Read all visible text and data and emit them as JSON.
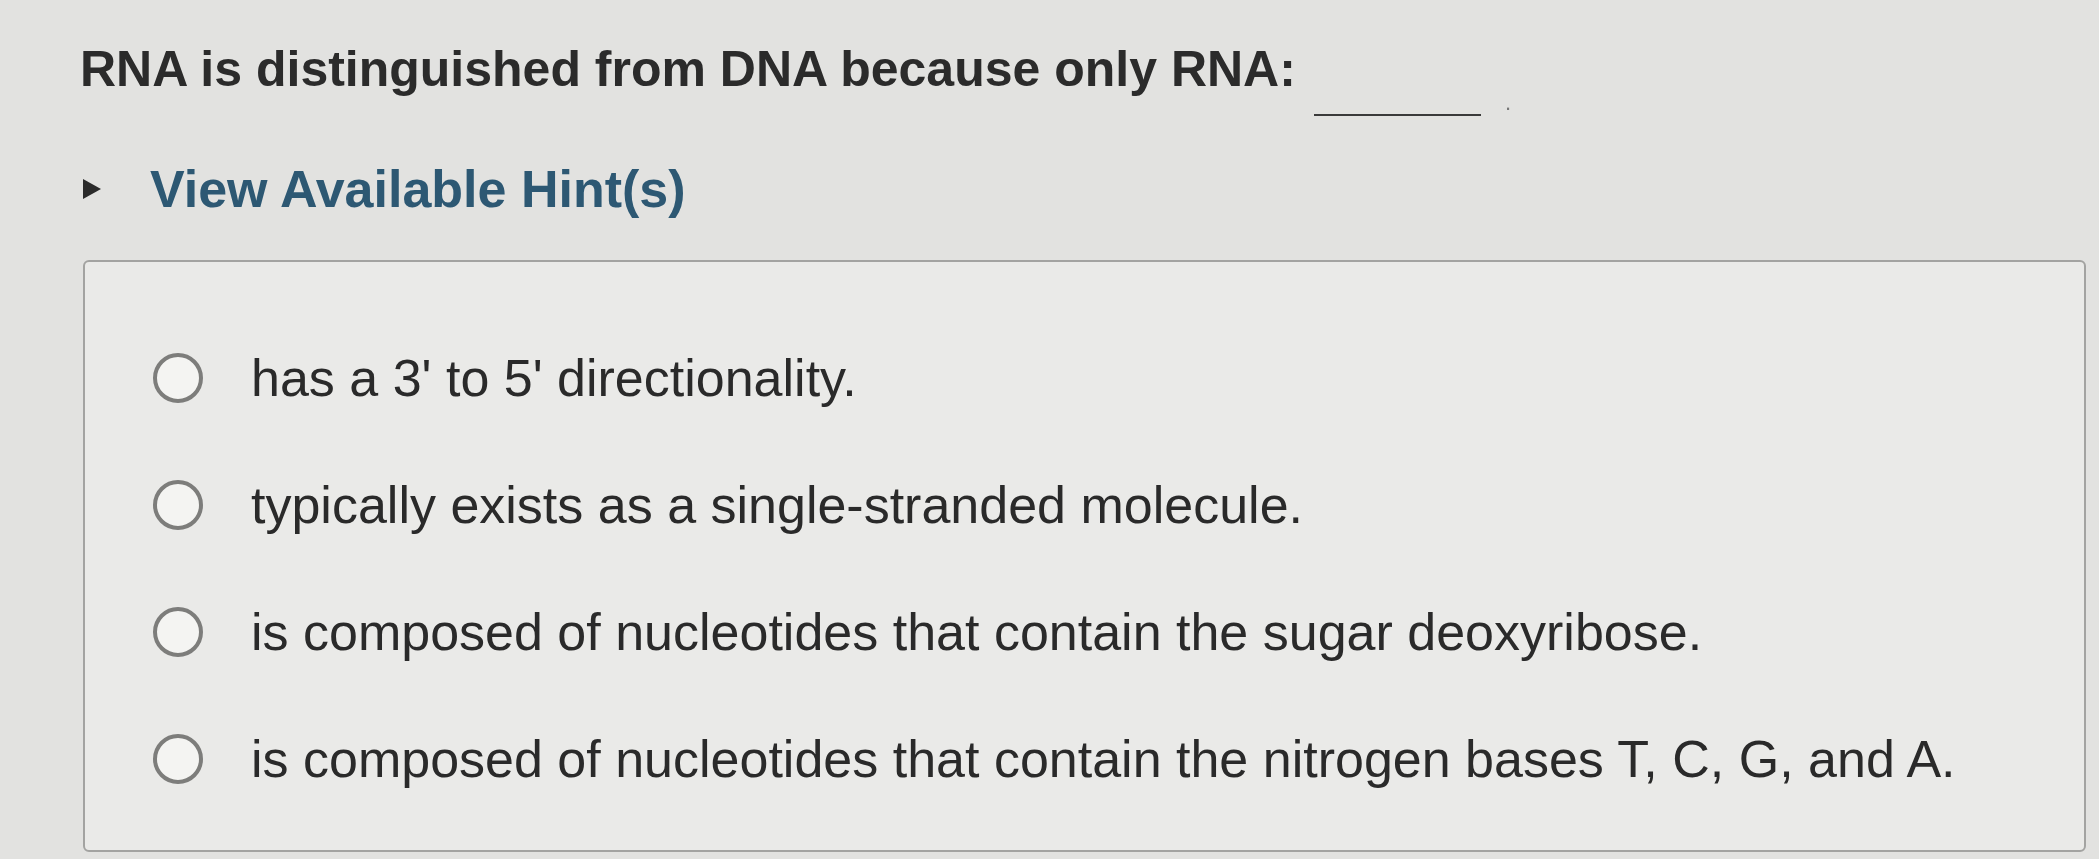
{
  "question": {
    "before_blank": "RNA is distinguished from DNA because only RNA:",
    "after_blank": "."
  },
  "hints": {
    "label": "View Available Hint(s)",
    "expanded": false
  },
  "options": [
    {
      "text": "has a 3' to 5' directionality.",
      "selected": false
    },
    {
      "text": "typically exists as a single-stranded molecule.",
      "selected": false
    },
    {
      "text": "is composed of nucleotides that contain the sugar deoxyribose.",
      "selected": false
    },
    {
      "text": "is composed of nucleotides that contain the nitrogen bases T, C, G, and A.",
      "selected": false
    }
  ]
}
